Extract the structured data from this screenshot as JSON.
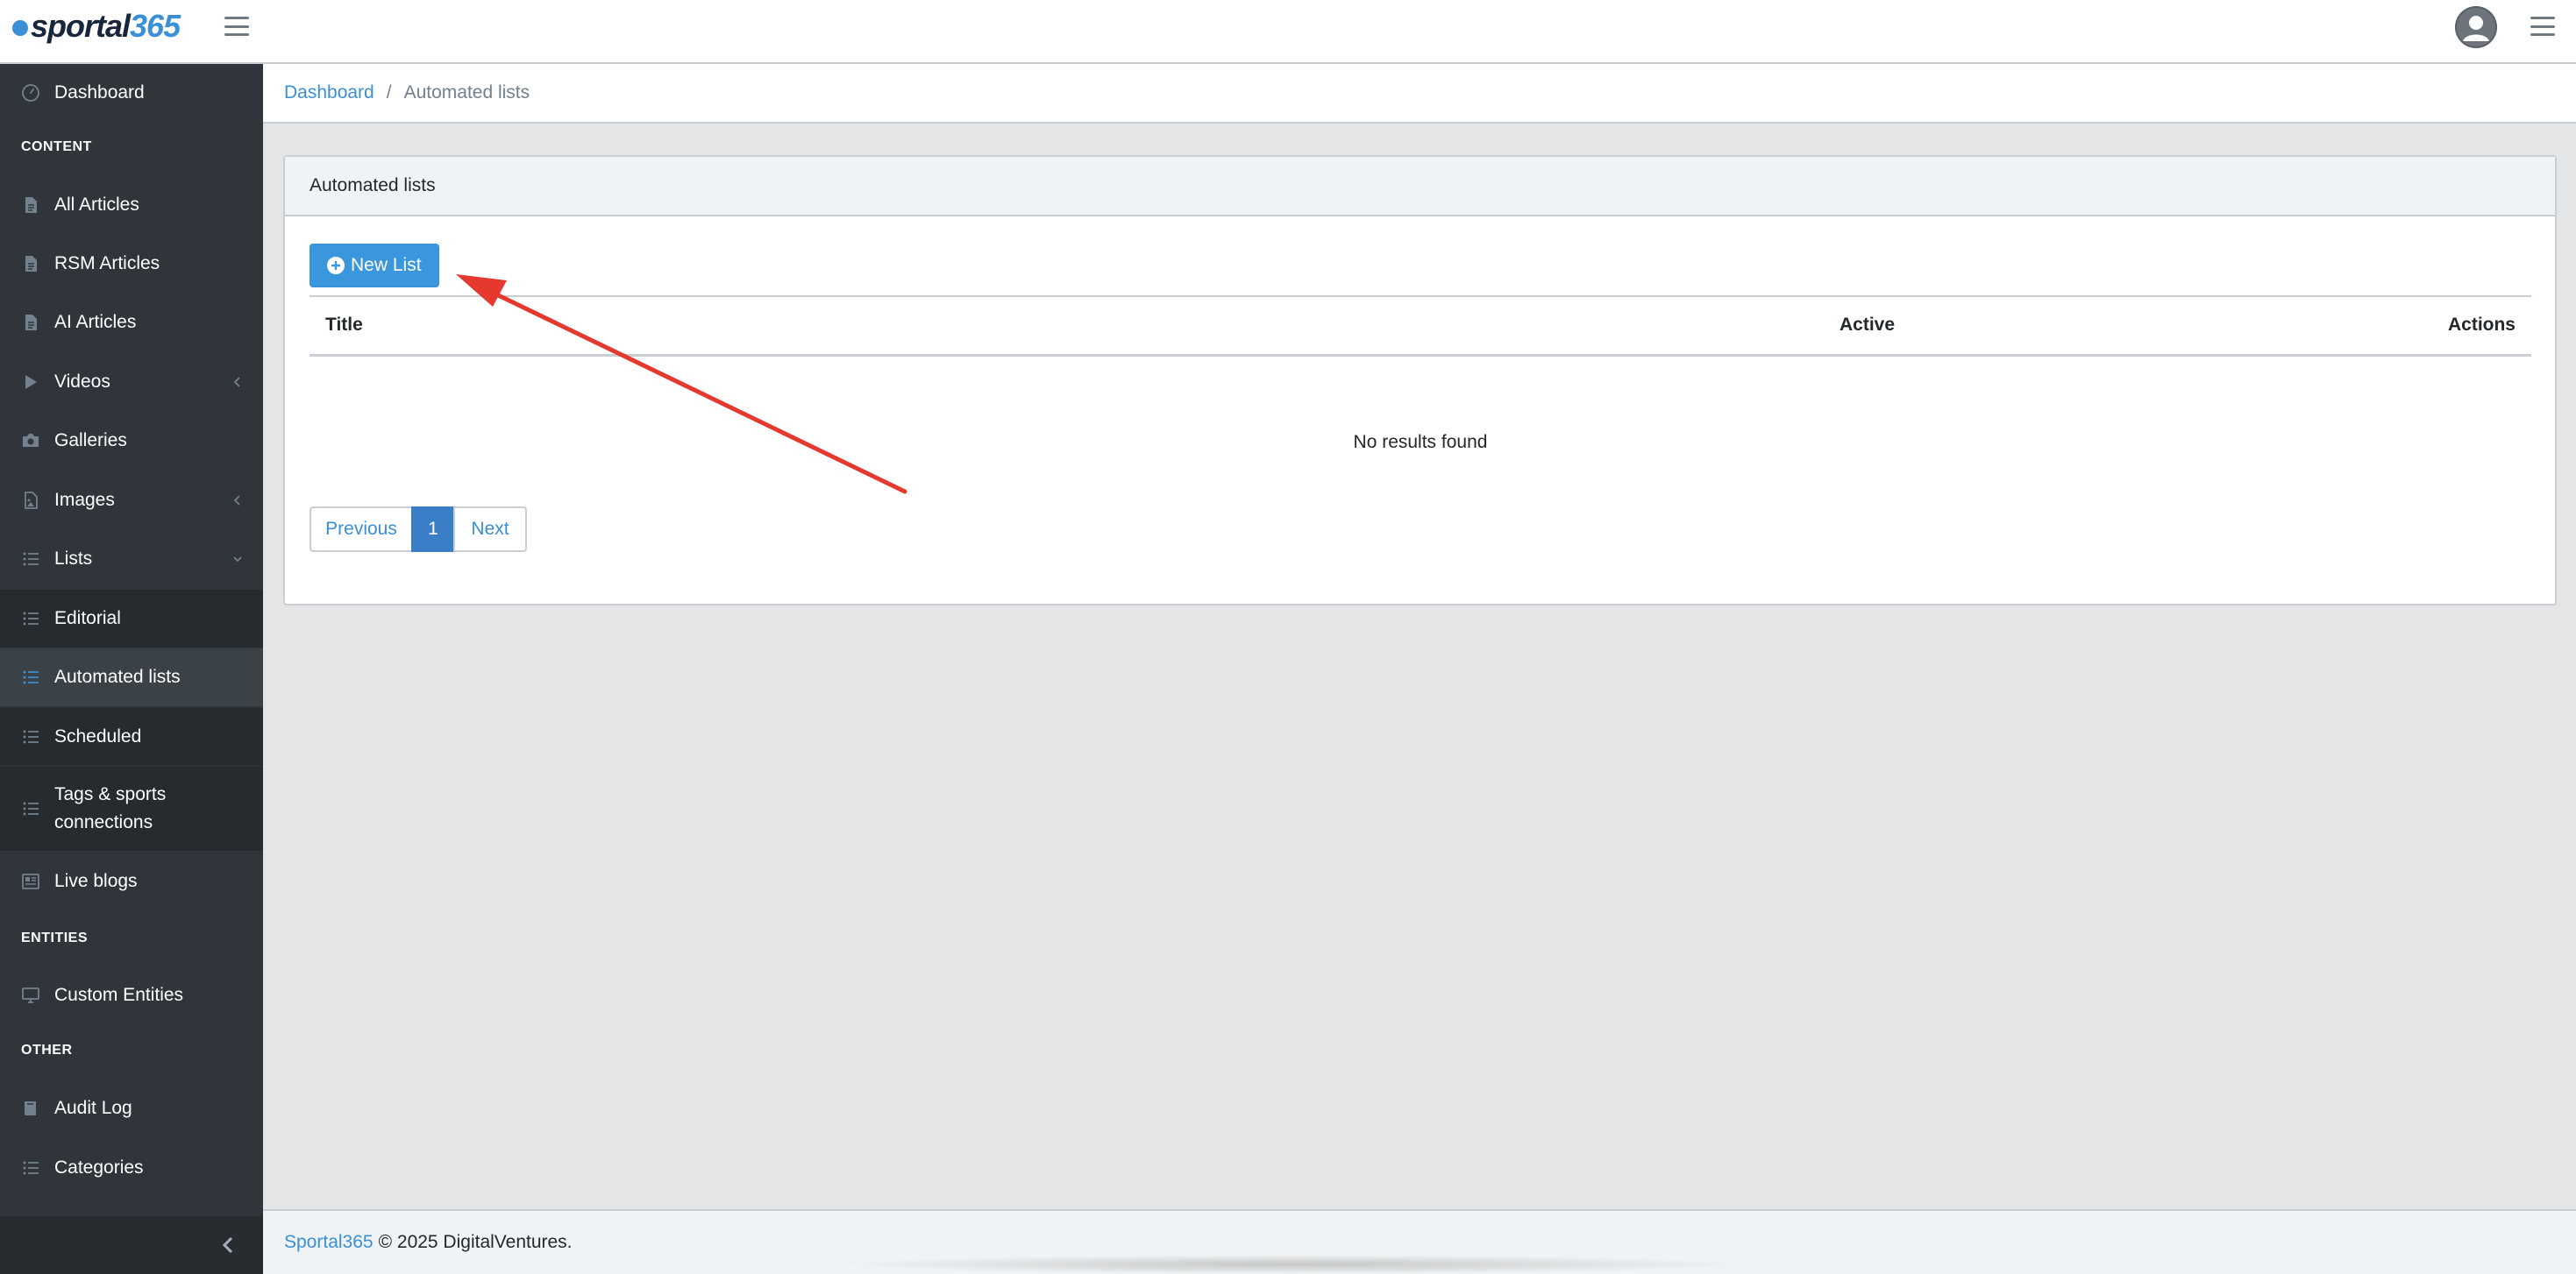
{
  "header": {
    "logo_main": "sportal",
    "logo_accent": "365",
    "menu_icon": "hamburger-icon",
    "avatar_icon": "user-avatar-icon"
  },
  "sidebar": {
    "items": [
      {
        "label": "Dashboard",
        "icon": "speedometer-icon"
      },
      {
        "section": "CONTENT"
      },
      {
        "label": "All Articles",
        "icon": "document-icon"
      },
      {
        "label": "RSM Articles",
        "icon": "document-icon"
      },
      {
        "label": "AI Articles",
        "icon": "document-icon"
      },
      {
        "label": "Videos",
        "icon": "play-icon"
      },
      {
        "label": "Galleries",
        "icon": "camera-icon"
      },
      {
        "label": "Images",
        "icon": "image-file-icon"
      },
      {
        "label": "Lists",
        "icon": "list-icon"
      },
      {
        "label": "Editorial",
        "icon": "list-icon"
      },
      {
        "label": "Automated lists",
        "icon": "list-icon"
      },
      {
        "label": "Scheduled",
        "icon": "list-icon"
      },
      {
        "label_line1": "Tags & sports",
        "label_line2": "connections",
        "icon": "list-icon"
      },
      {
        "label": "Live blogs",
        "icon": "newspaper-icon"
      },
      {
        "section": "ENTITIES"
      },
      {
        "label": "Custom Entities",
        "icon": "monitor-icon"
      },
      {
        "section": "OTHER"
      },
      {
        "label": "Audit Log",
        "icon": "book-icon"
      },
      {
        "label": "Categories",
        "icon": "list-icon"
      }
    ],
    "accent_color": "#3a8fd6"
  },
  "breadcrumb": {
    "home": "Dashboard",
    "separator": "/",
    "current": "Automated lists"
  },
  "card": {
    "title": "Automated lists",
    "new_button": "New List",
    "columns": [
      "Title",
      "Active",
      "Actions"
    ],
    "empty_message": "No results found",
    "pagination": {
      "previous": "Previous",
      "current_page": "1",
      "next": "Next"
    }
  },
  "footer": {
    "brand": "Sportal365",
    "copyright": "© 2025 DigitalVentures."
  },
  "colors": {
    "primary": "#3a97de",
    "sidebar_bg": "#2f353a",
    "annotation_arrow": "#e5392f"
  }
}
